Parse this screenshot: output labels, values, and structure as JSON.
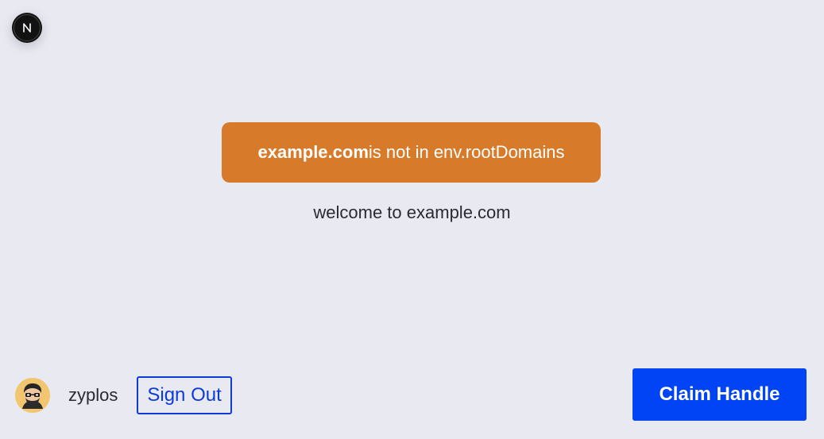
{
  "dev_indicator": {
    "icon": "nextjs-logo-icon",
    "letter": "N"
  },
  "warning": {
    "domain": "example.com",
    "message": " is not in env.rootDomains",
    "background_color": "#d77b2a"
  },
  "welcome": {
    "text": "welcome to example.com"
  },
  "user": {
    "avatar_icon": "avatar-icon",
    "username": "zyplos",
    "sign_out_label": "Sign Out"
  },
  "actions": {
    "claim_handle_label": "Claim Handle",
    "accent_color": "#0044f5"
  }
}
